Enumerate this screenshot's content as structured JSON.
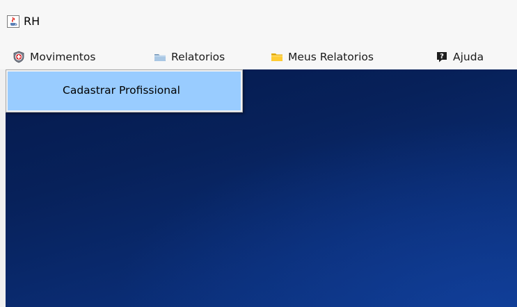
{
  "window": {
    "title": "RH",
    "icon": "java-cup-icon"
  },
  "menubar": {
    "items": [
      {
        "label": "Movimentos",
        "icon": "shield-red-cross-icon"
      },
      {
        "label": "Relatorios",
        "icon": "folder-blue-icon"
      },
      {
        "label": "Meus Relatorios",
        "icon": "folder-yellow-icon"
      },
      {
        "label": "Ajuda",
        "icon": "help-question-icon"
      }
    ]
  },
  "dropdown": {
    "open_menu": "Movimentos",
    "items": [
      {
        "label": "Cadastrar Profissional",
        "highlighted": true
      }
    ]
  },
  "colors": {
    "menu_highlight": "#99ccff",
    "desktop_dark": "#051a4d",
    "desktop_light": "#0c3583"
  }
}
